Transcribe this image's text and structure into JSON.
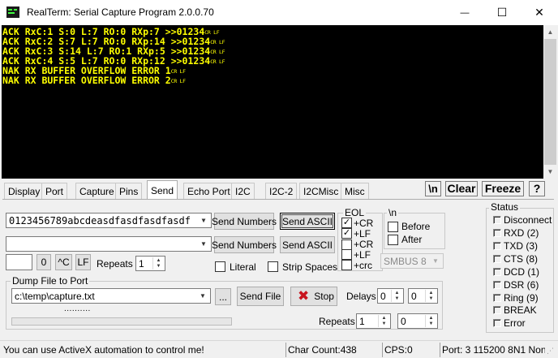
{
  "window": {
    "title": "RealTerm: Serial Capture Program 2.0.0.70",
    "minimize_glyph": "—",
    "maximize_glyph": "☐",
    "close_glyph": "✕"
  },
  "terminal": {
    "lines": [
      {
        "text": "ACK RxC:1 S:0 L:7 RO:0 RXp:7 >>01234",
        "crlf": "CR LF"
      },
      {
        "text": "ACK RxC:2 S:7 L:7 RO:0 RXp:14 >>01234",
        "crlf": "CR LF"
      },
      {
        "text": "ACK RxC:3 S:14 L:7 RO:1 RXp:5 >>01234",
        "crlf": "CR LF"
      },
      {
        "text": "ACK RxC:4 S:5 L:7 RO:0 RXp:12 >>01234",
        "crlf": "CR LF"
      },
      {
        "text": "NAK RX BUFFER OVERFLOW ERROR 1",
        "crlf": "CR LF"
      },
      {
        "text": "NAK RX BUFFER OVERFLOW ERROR 2",
        "crlf": "CR LF"
      }
    ],
    "text_color": "#ffff00",
    "background": "#000000"
  },
  "tabs": [
    "Display",
    "Port",
    "Capture",
    "Pins",
    "Send",
    "Echo Port",
    "I2C",
    "I2C-2",
    "I2CMisc",
    "Misc"
  ],
  "active_tab": "Send",
  "top_buttons": {
    "newline": "\\n",
    "clear": "Clear",
    "freeze": "Freeze",
    "help": "?"
  },
  "send": {
    "input1_value": "0123456789abcdeasdfasdfasdfasdf",
    "input2_value": "",
    "send_numbers_1": "Send Numbers",
    "send_ascii_1": "Send ASCII",
    "send_numbers_2": "Send Numbers",
    "send_ascii_2": "Send ASCII",
    "small_value": "",
    "btn_zero": "0",
    "btn_ctrl": "^C",
    "btn_lf": "LF",
    "repeats_label": "Repeats",
    "repeats_value": "1",
    "literal_label": "Literal",
    "strip_spaces_label": "Strip Spaces"
  },
  "eol": {
    "title": "EOL",
    "row1": [
      {
        "label": "+CR",
        "checked": true
      },
      {
        "label": "+LF",
        "checked": true
      }
    ],
    "row2": [
      {
        "label": "+CR",
        "checked": false
      },
      {
        "label": "+LF",
        "checked": false
      },
      {
        "label": "+crc",
        "checked": false
      }
    ]
  },
  "newline_group": {
    "title": "\\n",
    "before_label": "Before",
    "after_label": "After",
    "smbus_value": "SMBUS 8"
  },
  "dump": {
    "title": "Dump File to Port",
    "file_value": "c:\\temp\\capture.txt",
    "browse_label": "...",
    "send_file_label": "Send File",
    "stop_label": "Stop",
    "delays_label": "Delays",
    "delay1_value": "0",
    "delay2_value": "0",
    "progress_text": "..........",
    "repeats_label": "Repeats",
    "repeats1_value": "1",
    "repeats2_value": "0"
  },
  "status": {
    "title": "Status",
    "items": [
      "Disconnect",
      "RXD (2)",
      "TXD (3)",
      "CTS (8)",
      "DCD (1)",
      "DSR (6)",
      "Ring (9)",
      "BREAK",
      "Error"
    ]
  },
  "statusbar": {
    "message": "You can use ActiveX automation to control me!",
    "char_count": "Char Count:438",
    "cps": "CPS:0",
    "port": "Port: 3 115200 8N1 Non"
  }
}
